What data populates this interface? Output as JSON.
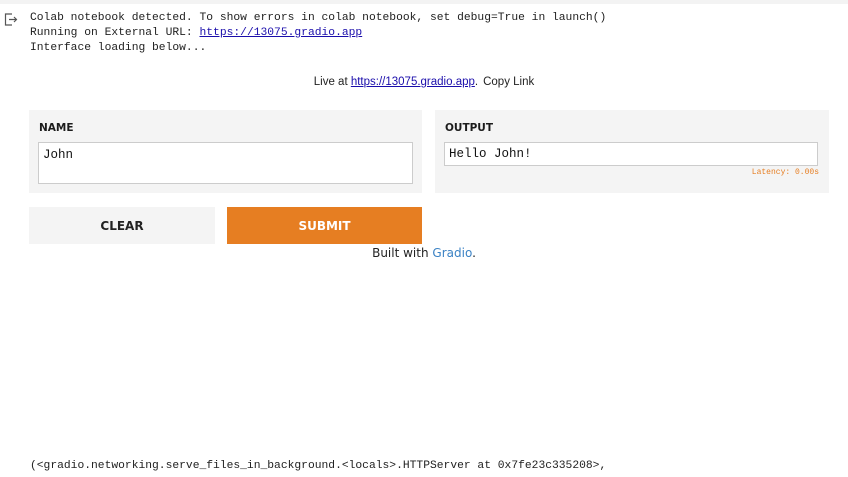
{
  "console": {
    "line1": "Colab notebook detected. To show errors in colab notebook, set debug=True in launch()",
    "line2_prefix": "Running on External URL: ",
    "line2_url": "https://13075.gradio.app",
    "line3": "Interface loading below..."
  },
  "live": {
    "prefix": "Live at ",
    "url": "https://13075.gradio.app",
    "suffix": ".",
    "copy_label": "Copy Link"
  },
  "input_panel": {
    "label": "NAME",
    "value": "John"
  },
  "output_panel": {
    "label": "OUTPUT",
    "value": "Hello John!",
    "latency": "Latency: 0.00s"
  },
  "buttons": {
    "clear": "CLEAR",
    "submit": "SUBMIT"
  },
  "footer": {
    "prefix": "Built with ",
    "brand": "Gradio",
    "suffix": "."
  },
  "result_line": "(<gradio.networking.serve_files_in_background.<locals>.HTTPServer at 0x7fe23c335208>,",
  "icons": {
    "output": "output-arrow-icon"
  },
  "colors": {
    "accent": "#e67e22",
    "link": "#1a0dab",
    "panel": "#f4f4f4"
  }
}
